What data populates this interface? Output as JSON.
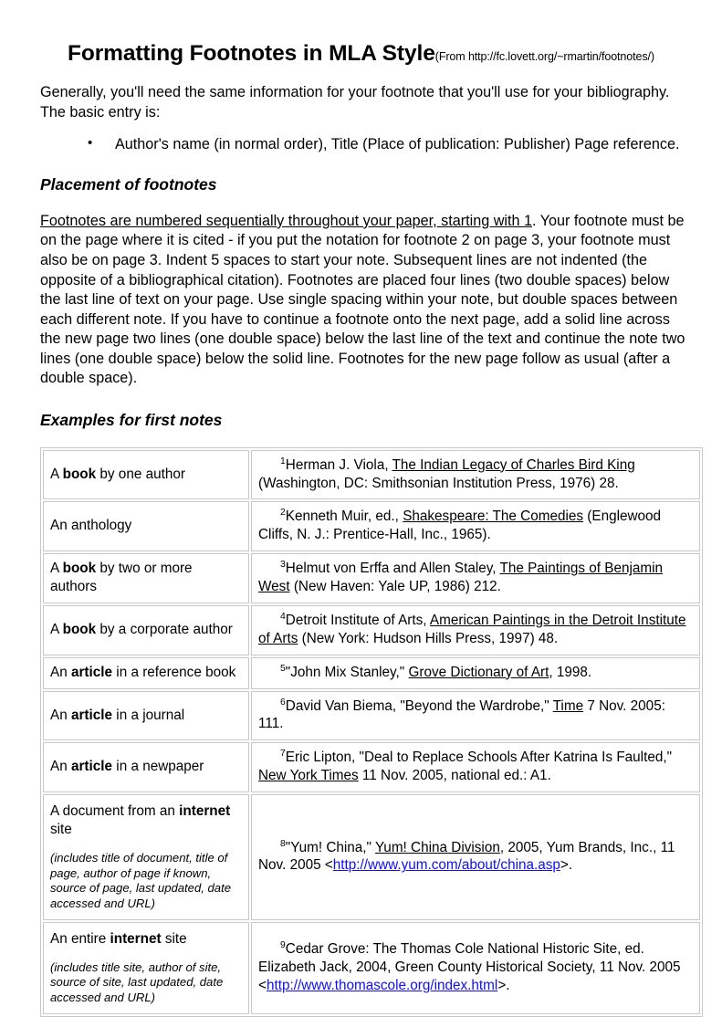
{
  "document": {
    "title_main": "Formatting Footnotes in MLA Style",
    "title_source": "(From http://fc.lovett.org/~rmartin/footnotes/)",
    "intro_paragraph": "Generally, you'll need the same information for your footnote that you'll use for your bibliography. The basic entry is:",
    "bullets": [
      "Author's name (in normal order), Title (Place of publication: Publisher) Page reference."
    ],
    "sections": [
      {
        "heading": "Placement of footnotes"
      },
      {
        "heading": "Examples for first notes"
      }
    ],
    "placement_paragraph": {
      "underlined_lead": "Footnotes are numbered sequentially throughout your paper, starting with 1",
      "rest": ". Your footnote must be on the page where it is cited - if you put the notation for footnote 2 on page 3, your footnote must also be on page 3. Indent 5 spaces to start your note. Subsequent lines are not indented (the opposite of a bibliographical citation). Footnotes are placed four lines (two double spaces) below the last line of text on your page. Use single spacing within your note, but double spaces between each different note. If you have to continue a footnote onto the next page, add a solid line across the new page two lines (one double space) below the last line of the text and continue the note two lines (one double space) below the solid line. Footnotes for the new page follow as usual (after a double space)."
    }
  },
  "table": {
    "rows": [
      {
        "label_pre": "A ",
        "label_bold": "book",
        "label_post": " by one author",
        "paren": "",
        "note_number": "1",
        "note_pre": "Herman J. Viola, ",
        "note_underline": "The Indian Legacy of Charles Bird King",
        "note_post": " (Washington, DC: Smithsonian Institution Press, 1976) 28.",
        "link_text": "",
        "note_tail": ""
      },
      {
        "label_pre": "An anthology",
        "label_bold": "",
        "label_post": "",
        "paren": "",
        "note_number": "2",
        "note_pre": "Kenneth Muir, ed., ",
        "note_underline": "Shakespeare: The Comedies",
        "note_post": " (Englewood Cliffs, N. J.: Prentice-Hall, Inc., 1965).",
        "link_text": "",
        "note_tail": ""
      },
      {
        "label_pre": "A ",
        "label_bold": "book",
        "label_post": " by two or more authors",
        "paren": "",
        "note_number": "3",
        "note_pre": "Helmut von Erffa and Allen Staley, ",
        "note_underline": "The Paintings of Benjamin West",
        "note_post": " (New Haven: Yale UP, 1986) 212.",
        "link_text": "",
        "note_tail": ""
      },
      {
        "label_pre": "A ",
        "label_bold": "book",
        "label_post": " by a corporate author",
        "paren": "",
        "note_number": "4",
        "note_pre": "Detroit Institute of Arts, ",
        "note_underline": "American Paintings in the Detroit Institute of Arts",
        "note_post": " (New York: Hudson Hills Press, 1997) 48.",
        "link_text": "",
        "note_tail": ""
      },
      {
        "label_pre": "An ",
        "label_bold": "article",
        "label_post": " in a reference book",
        "paren": "",
        "note_number": "5",
        "note_pre": "\"John Mix Stanley,\" ",
        "note_underline": "Grove Dictionary of Art",
        "note_post": ", 1998.",
        "link_text": "",
        "note_tail": ""
      },
      {
        "label_pre": "An ",
        "label_bold": "article",
        "label_post": " in a journal",
        "paren": "",
        "note_number": "6",
        "note_pre": "David Van Biema, \"Beyond the Wardrobe,\" ",
        "note_underline": "Time",
        "note_post": " 7 Nov. 2005: 111.",
        "link_text": "",
        "note_tail": ""
      },
      {
        "label_pre": "An ",
        "label_bold": "article",
        "label_post": " in a newpaper",
        "paren": "",
        "note_number": "7",
        "note_pre": "Eric Lipton, \"Deal to Replace Schools After Katrina Is Faulted,\" ",
        "note_underline": "New York Times",
        "note_post": " 11 Nov. 2005, national ed.: A1.",
        "link_text": "",
        "note_tail": ""
      },
      {
        "label_pre": "A document from an ",
        "label_bold": "internet",
        "label_post": " site",
        "paren": "(includes title of document, title of page, author of page if known, source of page, last updated, date accessed and URL)",
        "note_number": "8",
        "note_pre": "\"Yum! China,\" ",
        "note_underline": "Yum! China Division",
        "note_post": ", 2005, Yum Brands, Inc., 11 Nov. 2005 <",
        "link_text": "http://www.yum.com/about/china.asp",
        "note_tail": ">."
      },
      {
        "label_pre": "An entire ",
        "label_bold": "internet",
        "label_post": " site",
        "paren": "(includes title site, author of site, source of site, last updated, date accessed and URL)",
        "note_number": "9",
        "note_pre": "Cedar Grove: The Thomas Cole National Historic Site, ed. Elizabeth Jack, 2004, Green County Historical Society, 11 Nov. 2005 <",
        "note_underline": "",
        "note_post": "",
        "link_text": "http://www.thomascole.org/index.html",
        "note_tail": ">."
      }
    ]
  },
  "colors": {
    "link": "#1010ee",
    "table_border": "#c8c8c8",
    "text": "#000000"
  }
}
